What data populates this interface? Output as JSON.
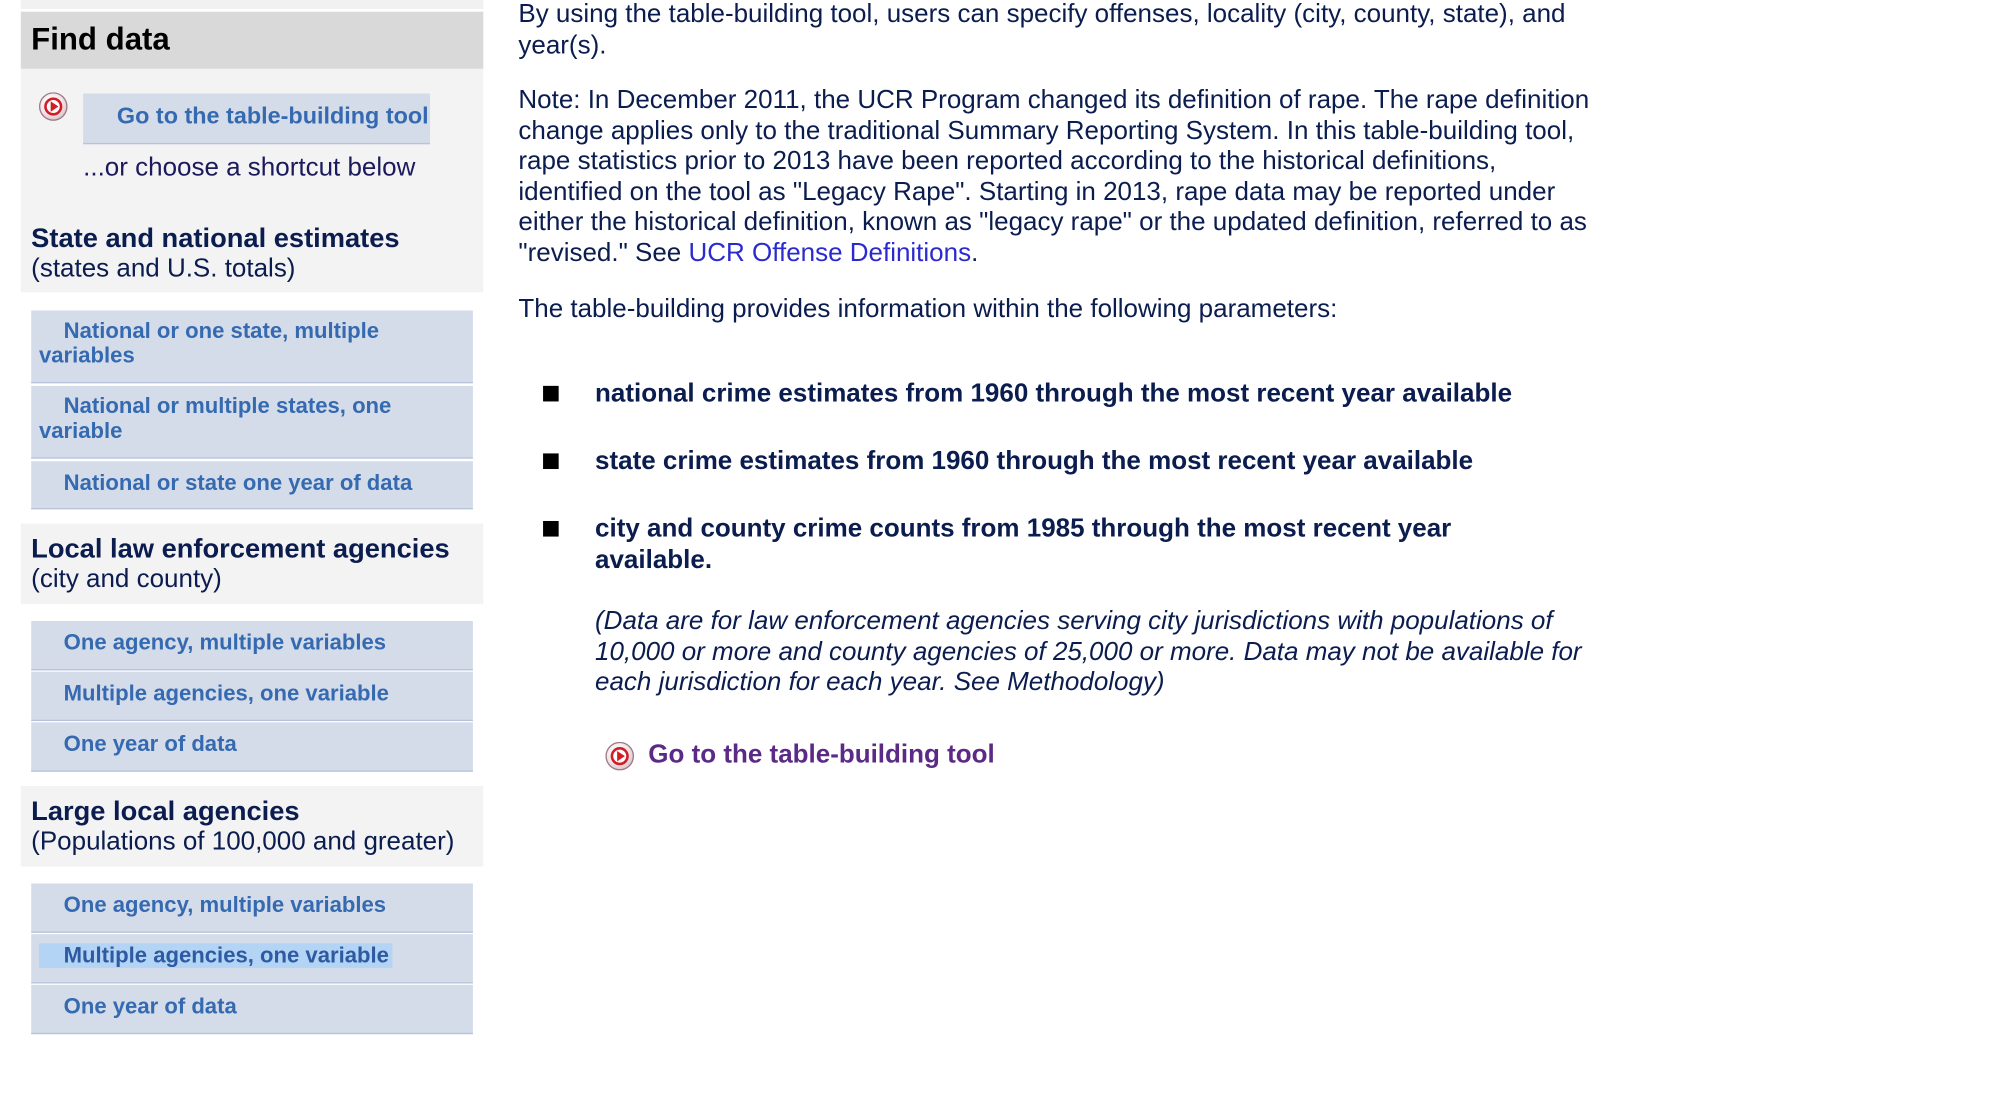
{
  "sidebar": {
    "header": "Find data",
    "tool_button": "Go to the table-building tool",
    "shortcut_text": "...or choose a shortcut below",
    "sections": [
      {
        "title": "State and national estimates",
        "subtitle": "(states and U.S. totals)",
        "links": [
          "National or one state, multiple variables",
          "National or multiple states, one variable",
          "National or state one year of data"
        ]
      },
      {
        "title": "Local law enforcement agencies",
        "subtitle": "(city and county)",
        "links": [
          "One agency, multiple variables",
          "Multiple agencies, one variable",
          "One year of data"
        ]
      },
      {
        "title": "Large local agencies",
        "subtitle": "(Populations of 100,000 and greater)",
        "links": [
          "One agency, multiple variables",
          "Multiple agencies, one variable",
          "One year of data"
        ]
      }
    ]
  },
  "main": {
    "intro": "By using the table-building tool, users can specify offenses, locality (city, county, state), and year(s).",
    "note_text": "Note: In December 2011, the UCR Program changed its definition of rape. The rape definition change applies only to the traditional Summary Reporting System. In this table-building tool, rape statistics prior to 2013 have been reported according to the historical definitions, identified on the tool as \"Legacy Rape\". Starting in 2013, rape data may be reported under either the historical definition, known as \"legacy rape\" or the updated definition, referred to as \"revised.\" See ",
    "note_link": "UCR Offense Definitions",
    "note_end": ".",
    "params_intro": "The table-building provides information within the following parameters:",
    "bullets": [
      "national crime estimates from 1960 through the most recent year available",
      "state crime estimates from 1960 through the most recent year available",
      "city and county crime counts from 1985 through the most recent year available."
    ],
    "data_note": "(Data are for law enforcement agencies serving city jurisdictions with populations of 10,000 or more and county agencies of 25,000 or more. Data may not be available for each jurisdiction for each year. See Methodology)",
    "tool_link": "Go to the table-building tool"
  },
  "colors": {
    "link_box_bg": "#d4dcea",
    "link_text": "#356ab1",
    "body_text": "#0b1c4f",
    "header_bg": "#d9d9d9",
    "highlight": "#b3d4f5"
  },
  "icons": [
    "play-arrow-icon"
  ]
}
